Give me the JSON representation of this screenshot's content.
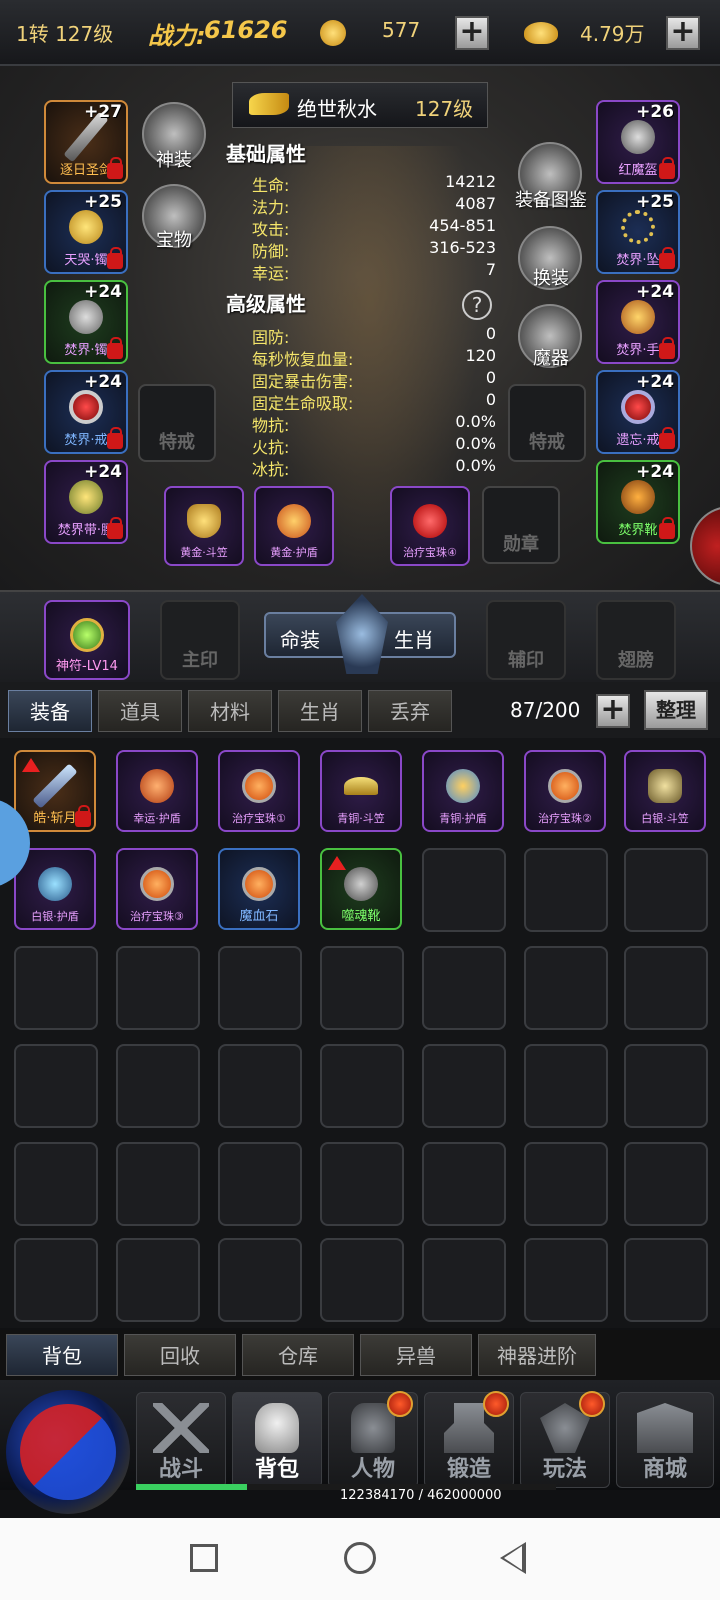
{
  "topbar": {
    "level": "1转 127级",
    "combat_label": "战力:",
    "combat_value": "61626",
    "coupon": "577",
    "gold": "4.79万"
  },
  "character": {
    "title": "绝世秋水",
    "title_level": "127级"
  },
  "basic": {
    "heading": "基础属性",
    "rows": [
      {
        "k": "生命:",
        "v": "14212"
      },
      {
        "k": "法力:",
        "v": "4087"
      },
      {
        "k": "攻击:",
        "v": "454-851"
      },
      {
        "k": "防御:",
        "v": "316-523"
      },
      {
        "k": "幸运:",
        "v": "7"
      }
    ]
  },
  "advanced": {
    "heading": "高级属性",
    "rows": [
      {
        "k": "固防:",
        "v": "0"
      },
      {
        "k": "每秒恢复血量:",
        "v": "120"
      },
      {
        "k": "固定暴击伤害:",
        "v": "0"
      },
      {
        "k": "固定生命吸取:",
        "v": "0"
      },
      {
        "k": "物抗:",
        "v": "0.0%"
      },
      {
        "k": "火抗:",
        "v": "0.0%"
      },
      {
        "k": "冰抗:",
        "v": "0.0%"
      }
    ]
  },
  "round_buttons": {
    "shenzhuang": "神装",
    "baowu": "宝物",
    "tujian": "装备图鉴",
    "huanzhuang": "换装",
    "moqi": "魔器"
  },
  "left_slots": [
    {
      "lvl": "+27",
      "name": "逐日圣剑"
    },
    {
      "lvl": "+25",
      "name": "天哭·镯"
    },
    {
      "lvl": "+24",
      "name": "焚界·镯"
    },
    {
      "lvl": "+24",
      "name": "焚界·戒"
    },
    {
      "lvl": "+24",
      "name": "焚界带·腰"
    }
  ],
  "right_slots": [
    {
      "lvl": "+26",
      "name": "红魔盔"
    },
    {
      "lvl": "+25",
      "name": "焚界·坠"
    },
    {
      "lvl": "+24",
      "name": "焚界·手"
    },
    {
      "lvl": "+24",
      "name": "遗忘·戒"
    },
    {
      "lvl": "+24",
      "name": "焚界靴"
    }
  ],
  "special": {
    "te1": "特戒",
    "te2": "特戒"
  },
  "bottom_slots": [
    {
      "name": "黄金·斗笠"
    },
    {
      "name": "黄金·护盾"
    },
    {
      "name": "治疗宝珠④"
    },
    {
      "name": "勋章"
    }
  ],
  "midband": {
    "shenfu": "神符-LV14",
    "zhuyin": "主印",
    "mingzhuang": "命装",
    "shengxiao": "生肖",
    "fuyin": "辅印",
    "chibang": "翅膀"
  },
  "inv_tabs": [
    "装备",
    "道具",
    "材料",
    "生肖",
    "丢弃"
  ],
  "inv_count": "87/200",
  "sort_label": "整理",
  "items": [
    {
      "name": "皓·斩月"
    },
    {
      "name": "幸运·护盾"
    },
    {
      "name": "治疗宝珠①"
    },
    {
      "name": "青铜·斗笠"
    },
    {
      "name": "青铜·护盾"
    },
    {
      "name": "治疗宝珠②"
    },
    {
      "name": "白银·斗笠"
    },
    {
      "name": "白银·护盾"
    },
    {
      "name": "治疗宝珠③"
    },
    {
      "name": "魔血石"
    },
    {
      "name": "噬魂靴"
    }
  ],
  "bottom_tabs": [
    "背包",
    "回收",
    "仓库",
    "异兽",
    "神器进阶"
  ],
  "nav": [
    "战斗",
    "背包",
    "人物",
    "锻造",
    "玩法",
    "商城"
  ],
  "exp": "122384170 / 462000000",
  "colors": {
    "gold": "#f0d27a",
    "attr_key": "#f4e56a",
    "purple": "#8a48c8",
    "green": "#49c040",
    "orange": "#d08a3a",
    "blue": "#3a6fc0"
  }
}
